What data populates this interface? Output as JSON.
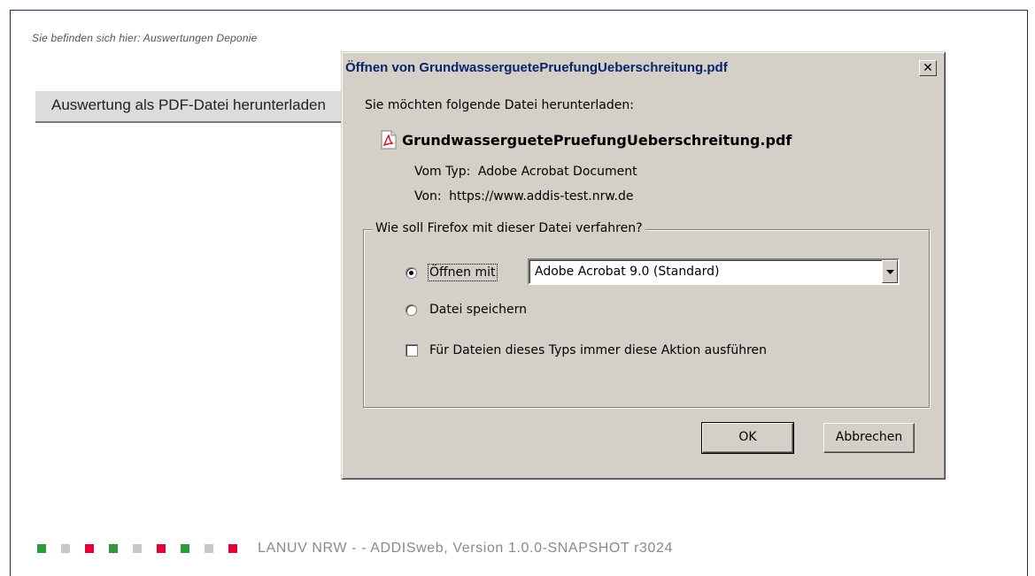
{
  "page": {
    "breadcrumb": "Sie befinden sich hier: Auswertungen Deponie",
    "pdf_button_label": "Auswertung als PDF-Datei herunterladen",
    "footer_text": "LANUV NRW - - ADDISweb, Version 1.0.0-SNAPSHOT r3024",
    "footer_squares": [
      "green",
      "lightgray",
      "red",
      "green",
      "lightgray",
      "red",
      "green",
      "lightgray",
      "red"
    ],
    "colors": {
      "green": "#2e9a3a",
      "lightgray": "#c8c8c8",
      "red": "#e4003a"
    }
  },
  "dialog": {
    "title": "Öffnen von GrundwasserguetePruefungUeberschreitung.pdf",
    "close_symbol": "✕",
    "intro": "Sie möchten folgende Datei herunterladen:",
    "file_icon": "pdf-icon",
    "file_name": "GrundwasserguetePruefungUeberschreitung.pdf",
    "type_label": "Vom Typ:",
    "type_value": "Adobe Acrobat Document",
    "from_label": "Von:",
    "from_value": "https://www.addis-test.nrw.de",
    "group_label": "Wie soll Firefox mit dieser Datei verfahren?",
    "open_with_label": "Öffnen mit",
    "open_with_app": "Adobe Acrobat 9.0 (Standard)",
    "save_label": "Datei speichern",
    "always_label": "Für Dateien dieses Typs immer diese Aktion ausführen",
    "selected_option": "open_with",
    "always_checked": false,
    "ok_label": "OK",
    "cancel_label": "Abbrechen"
  }
}
